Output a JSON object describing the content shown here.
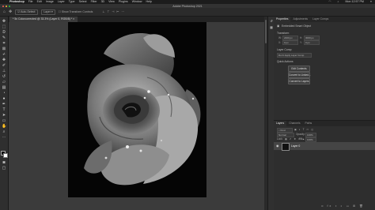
{
  "menubar": {
    "apple": "",
    "items": [
      "Photoshop",
      "File",
      "Edit",
      "Image",
      "Layer",
      "Type",
      "Select",
      "Filter",
      "3D",
      "View",
      "Plugins",
      "Window",
      "Help"
    ],
    "clock": "Mon 12:57 PM"
  },
  "window": {
    "title": "Adobe Photoshop 2021"
  },
  "options_bar": {
    "home_icon": "home-icon",
    "tool_icon": "move-tool-icon",
    "auto_select_label": "Auto-Select:",
    "layer_dropdown": "Layer",
    "show_transform": "Show Transform Controls"
  },
  "document": {
    "tab_title": "* 5x Colorcorrected @ 33.3% (Layer 0, RGB/8) *"
  },
  "toolbar": {
    "tools": [
      "move-tool-icon",
      "marquee-tool-icon",
      "lasso-tool-icon",
      "quick-select-tool-icon",
      "crop-tool-icon",
      "frame-tool-icon",
      "eyedropper-tool-icon",
      "healing-tool-icon",
      "brush-tool-icon",
      "stamp-tool-icon",
      "history-brush-tool-icon",
      "eraser-tool-icon",
      "gradient-tool-icon",
      "blur-tool-icon",
      "dodge-tool-icon",
      "pen-tool-icon",
      "type-tool-icon",
      "path-select-tool-icon",
      "shape-tool-icon",
      "hand-tool-icon",
      "zoom-tool-icon",
      "more-tools-icon"
    ],
    "foreground_color": "#111111",
    "background_color": "#ffffff"
  },
  "properties_panel": {
    "tabs": [
      "Properties",
      "Adjustments",
      "Layer Comps"
    ],
    "layer_kind": "Embedded Smart Object",
    "transform_label": "Transform",
    "w_label": "W:",
    "h_label": "H:",
    "x_label": "X:",
    "y_label": "Y:",
    "w_value": "2400 px",
    "h_value": "3000 px",
    "x_value": "0 px",
    "y_value": "0 px",
    "layer_comp_label": "Layer Comp",
    "layer_comp_value": "Don't Apply Layer Comp",
    "quick_actions_label": "Quick Actions",
    "buttons": [
      "Edit Contents",
      "Convert to Linked...",
      "Convert to Layers"
    ]
  },
  "layers_panel": {
    "tabs": [
      "Layers",
      "Channels",
      "Paths"
    ],
    "kind_label": "Kind",
    "blend_mode": "Normal",
    "opacity_label": "Opacity:",
    "opacity_value": "100%",
    "lock_label": "Lock:",
    "fill_label": "Fill:",
    "fill_value": "100%",
    "layer_name": "Layer 0"
  },
  "colors": {
    "canvas_bg": "#3b3b3b",
    "panel_bg": "#2e2e2e",
    "photo_bg": "#050505"
  }
}
